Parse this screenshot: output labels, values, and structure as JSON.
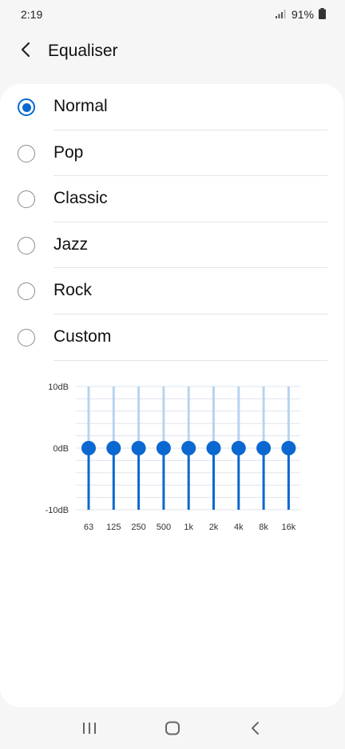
{
  "status_bar": {
    "time": "2:19",
    "battery_percent": "91%",
    "signal_icon": "signal-icon",
    "battery_icon": "battery-icon"
  },
  "app_bar": {
    "back_icon": "chevron-left-icon",
    "title": "Equaliser"
  },
  "presets": [
    {
      "label": "Normal",
      "selected": true
    },
    {
      "label": "Pop",
      "selected": false
    },
    {
      "label": "Classic",
      "selected": false
    },
    {
      "label": "Jazz",
      "selected": false
    },
    {
      "label": "Rock",
      "selected": false
    },
    {
      "label": "Custom",
      "selected": false
    }
  ],
  "equalizer": {
    "y_labels": [
      "10dB",
      "0dB",
      "-10dB"
    ],
    "ylim_db": [
      -10,
      10
    ],
    "bands": [
      "63",
      "125",
      "250",
      "500",
      "1k",
      "2k",
      "4k",
      "8k",
      "16k"
    ],
    "gains_db": [
      0,
      0,
      0,
      0,
      0,
      0,
      0,
      0,
      0
    ],
    "colors": {
      "accent": "#0a68d0",
      "track_light": "#b7d4ef",
      "grid": "#dde5ee"
    }
  },
  "nav_bar": {
    "recents_icon": "recents-icon",
    "home_icon": "home-icon",
    "back_icon": "back-icon"
  }
}
